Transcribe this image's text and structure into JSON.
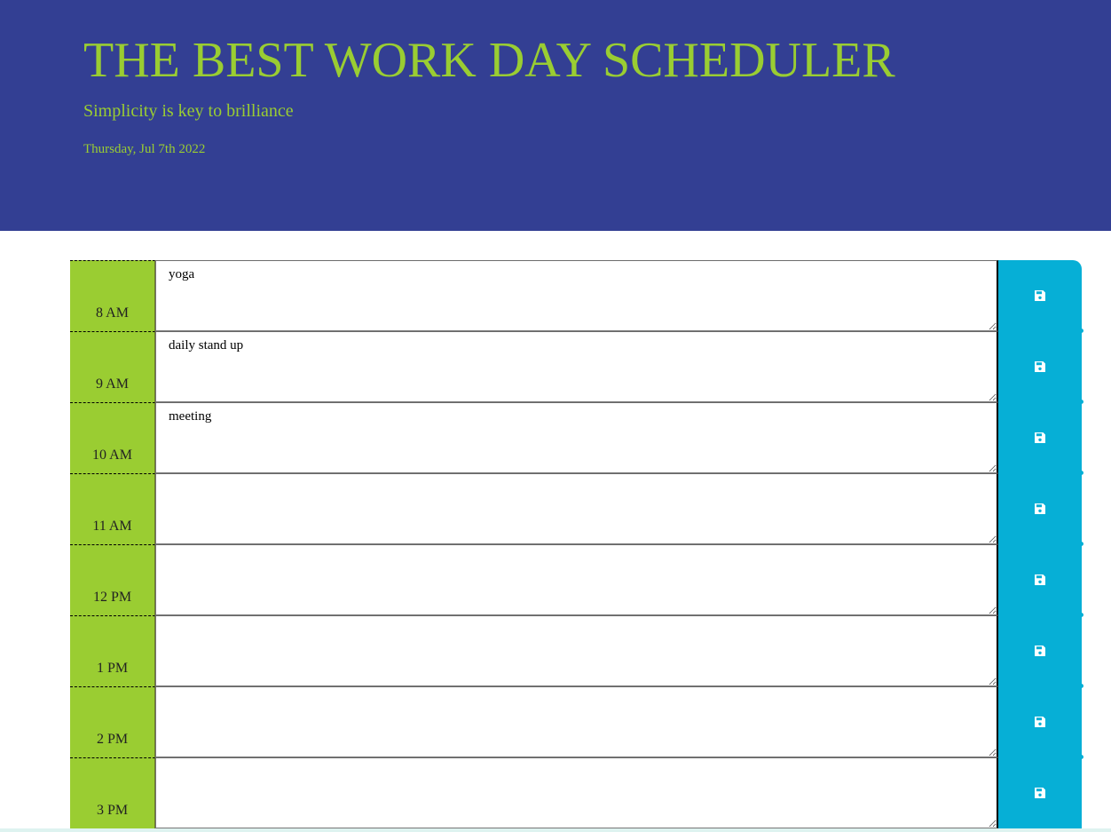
{
  "header": {
    "title": "THE BEST WORK DAY SCHEDULER",
    "tagline": "Simplicity is key to brilliance",
    "current_day": "Thursday, Jul 7th 2022"
  },
  "colors": {
    "header_bg": "#333f93",
    "accent_green": "#9acd32",
    "save_blue": "#06afd6"
  },
  "schedule": [
    {
      "hour": "8 AM",
      "description": "yoga"
    },
    {
      "hour": "9 AM",
      "description": "daily stand up"
    },
    {
      "hour": "10 AM",
      "description": "meeting"
    },
    {
      "hour": "11 AM",
      "description": ""
    },
    {
      "hour": "12 PM",
      "description": ""
    },
    {
      "hour": "1 PM",
      "description": ""
    },
    {
      "hour": "2 PM",
      "description": ""
    },
    {
      "hour": "3 PM",
      "description": ""
    }
  ],
  "icons": {
    "save": "save-icon"
  }
}
